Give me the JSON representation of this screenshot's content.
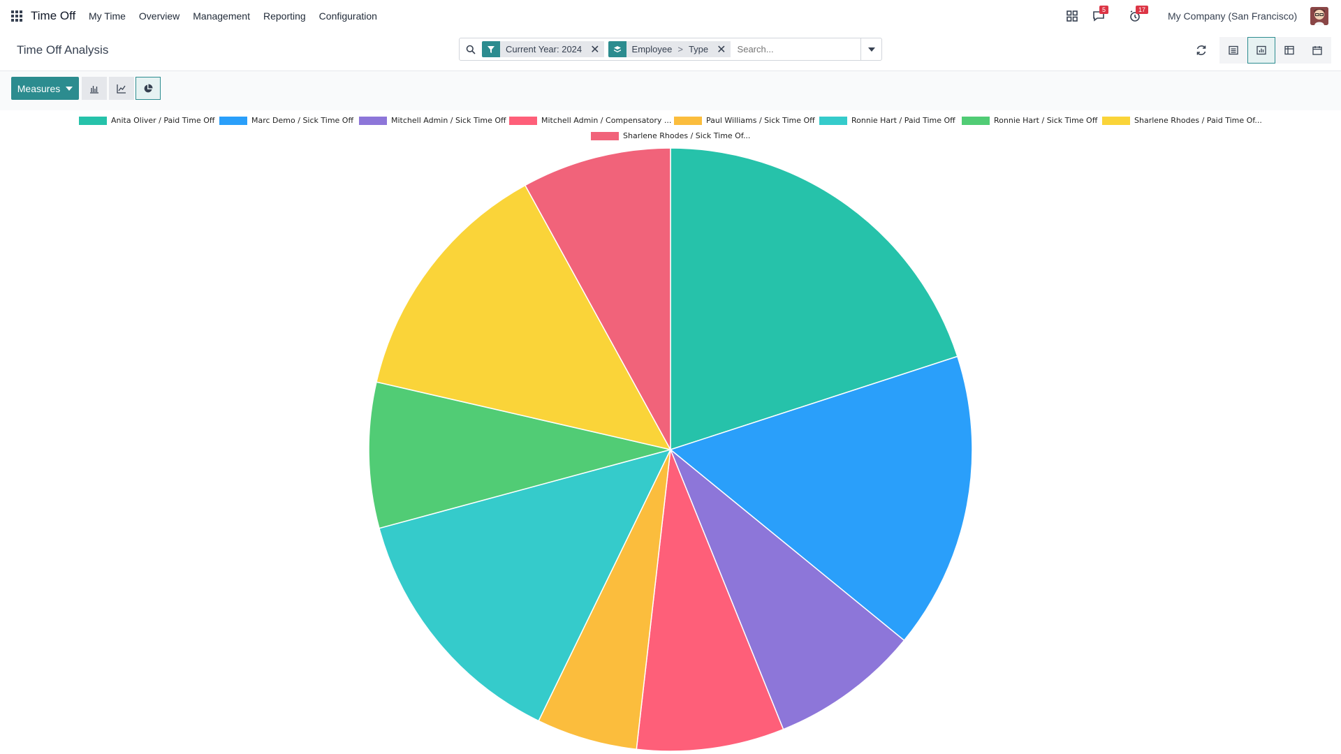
{
  "app": {
    "name": "Time Off",
    "menu": [
      "My Time",
      "Overview",
      "Management",
      "Reporting",
      "Configuration"
    ],
    "messages_count": "5",
    "activities_count": "17",
    "company": "My Company (San Francisco)"
  },
  "control_panel": {
    "title": "Time Off Analysis",
    "facets": [
      {
        "icon": "filter-icon",
        "values": [
          "Current Year: 2024"
        ]
      },
      {
        "icon": "group-by-icon",
        "values": [
          "Employee",
          "Type"
        ],
        "separator": ">"
      }
    ],
    "search_placeholder": "Search..."
  },
  "toolbar": {
    "measures_label": "Measures",
    "chart_types": [
      "bar",
      "line",
      "pie"
    ],
    "active_chart_type": "pie"
  },
  "chart_data": {
    "type": "pie",
    "labels": [
      "Anita Oliver / Paid Time Off",
      "Marc Demo / Sick Time Off",
      "Mitchell Admin / Sick Time Off",
      "Mitchell Admin / Compensatory ...",
      "Paul Williams / Sick Time Off",
      "Ronnie Hart / Paid Time Off",
      "Ronnie Hart / Sick Time Off",
      "Sharlene Rhodes / Paid Time Of...",
      "Sharlene Rhodes / Sick Time Of..."
    ],
    "values": [
      20.0,
      15.9,
      8.0,
      7.9,
      5.4,
      13.6,
      7.8,
      13.4,
      8.0
    ],
    "colors": [
      "#26c2aa",
      "#2a9ffa",
      "#8d76d9",
      "#fe5f79",
      "#fbbd3d",
      "#35cbcb",
      "#51cc75",
      "#fad439",
      "#f1637a"
    ],
    "legend_position": "top"
  }
}
